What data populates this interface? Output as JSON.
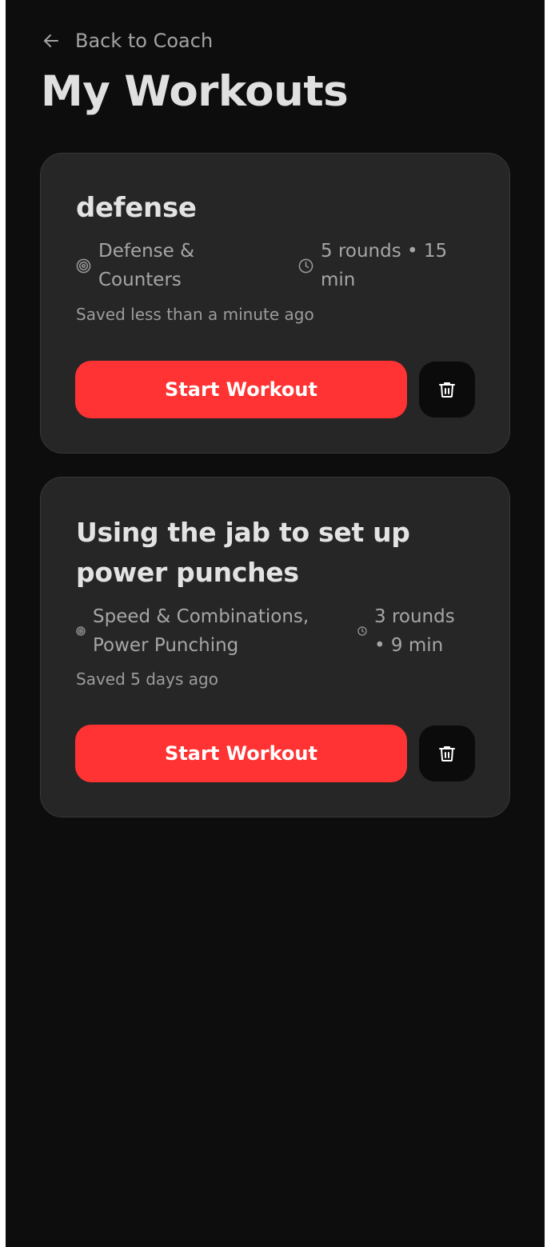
{
  "nav": {
    "back_label": "Back to Coach",
    "back_icon": "arrow-left-icon"
  },
  "page": {
    "title": "My Workouts"
  },
  "colors": {
    "background": "#0d0d0d",
    "card": "#262626",
    "accent": "#ff3333",
    "text_primary": "#e3e3e3",
    "text_secondary": "#a6a6a6"
  },
  "workouts": [
    {
      "title": "defense",
      "focus_icon": "target-icon",
      "focus_line1": "Defense &",
      "focus_line2": "Counters",
      "duration_icon": "clock-icon",
      "duration_line1": "5 rounds • 15",
      "duration_line2": "min",
      "saved": "Saved less than a minute ago",
      "start_label": "Start Workout",
      "delete_icon": "trash-icon"
    },
    {
      "title_line1": "Using the jab to set up",
      "title_line2": "power punches",
      "focus_icon": "target-icon",
      "focus_line1": "Speed & Combinations,",
      "focus_line2": "Power Punching",
      "duration_icon": "clock-icon",
      "duration_line1": "3 rounds",
      "duration_line2": "• 9 min",
      "saved": "Saved 5 days ago",
      "start_label": "Start Workout",
      "delete_icon": "trash-icon"
    }
  ]
}
